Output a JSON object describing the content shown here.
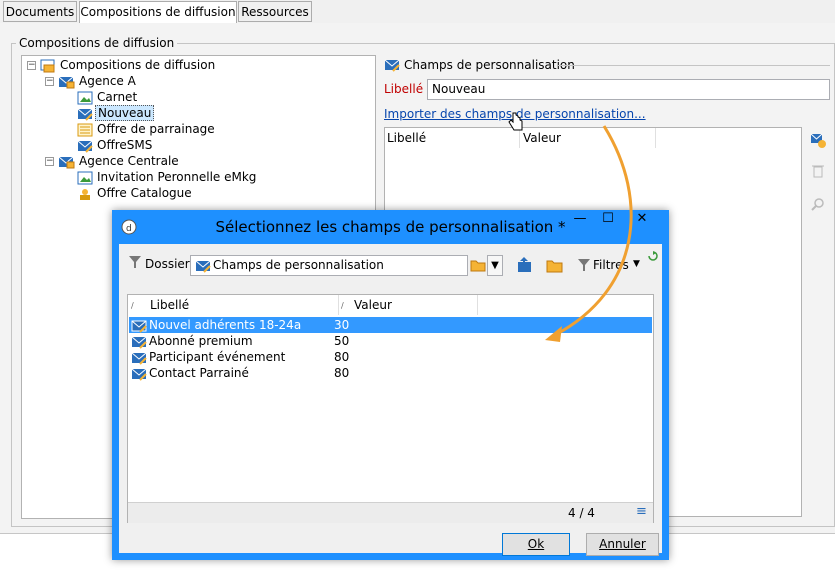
{
  "tabs": [
    "Documents",
    "Compositions de diffusion",
    "Ressources"
  ],
  "group_title": "Compositions de diffusion",
  "tree": {
    "root": "Compositions de diffusion",
    "agence_a": "Agence A",
    "agence_a_items": [
      "Carnet",
      "Nouveau",
      "Offre de parrainage",
      "OffreSMS"
    ],
    "agence_centrale": "Agence Centrale",
    "agence_centrale_items": [
      "Invitation Peronnelle eMkg",
      "Offre Catalogue"
    ]
  },
  "right_panel": {
    "section_title": "Champs de personnalisation",
    "libelle_label": "Libellé :",
    "libelle_value": "Nouveau",
    "import_link": "Importer des champs de personnalisation...",
    "columns": [
      "Libellé",
      "Valeur"
    ]
  },
  "dialog": {
    "title": "Sélectionnez les champs de personnalisation *",
    "folder_label": "Dossier :",
    "folder_value": "Champs de personnalisation",
    "filters_label": "Filtres",
    "columns": [
      "Libellé",
      "Valeur"
    ],
    "rows": [
      {
        "label": "Nouvel adhérents 18-24a",
        "value": "30"
      },
      {
        "label": "Abonné premium",
        "value": "50"
      },
      {
        "label": "Participant événement",
        "value": "80"
      },
      {
        "label": "Contact Parrainé",
        "value": "80"
      }
    ],
    "pager": "4 / 4",
    "ok_label": "Ok",
    "cancel_label": "Annuler"
  },
  "colors": {
    "accent": "#1e90ff",
    "selection": "#3399ff",
    "arrow": "#f0a030",
    "required_label": "#c00000"
  }
}
